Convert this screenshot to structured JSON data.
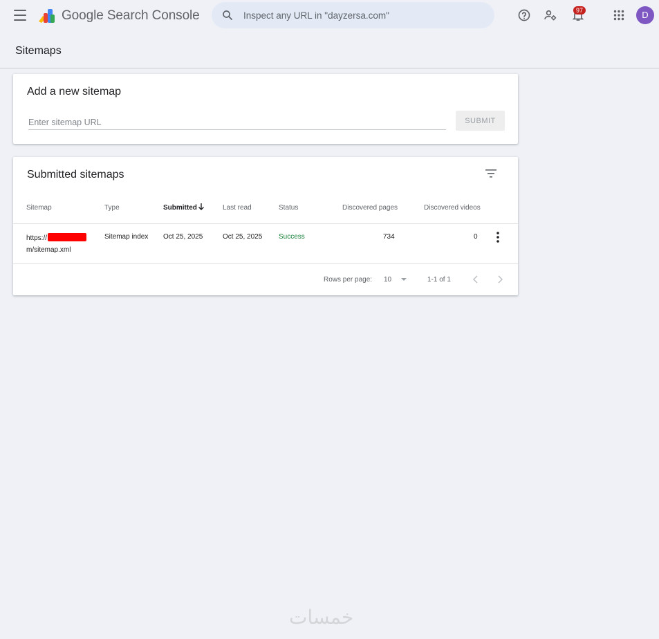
{
  "header": {
    "app_title": "Google Search Console",
    "search_placeholder": "Inspect any URL in \"dayzersa.com\"",
    "notification_count": "97",
    "avatar_letter": "D",
    "icons": [
      "menu-icon",
      "search-console-logo",
      "search-icon",
      "help-icon",
      "account-settings-icon",
      "notifications-icon",
      "apps-icon"
    ]
  },
  "page": {
    "title": "Sitemaps"
  },
  "add_sitemap": {
    "heading": "Add a new sitemap",
    "input_placeholder": "Enter sitemap URL",
    "submit_label": "SUBMIT"
  },
  "submitted": {
    "heading": "Submitted sitemaps",
    "columns": [
      "Sitemap",
      "Type",
      "Submitted",
      "Last read",
      "Status",
      "Discovered pages",
      "Discovered videos"
    ],
    "sorted_column": "Submitted",
    "rows": [
      {
        "sitemap_prefix": "https://",
        "sitemap_suffix": "m/sitemap.xml",
        "type": "Sitemap index",
        "submitted": "Oct 25, 2025",
        "last_read": "Oct 25, 2025",
        "status": "Success",
        "discovered_pages": "734",
        "discovered_videos": "0"
      }
    ],
    "pagination": {
      "rows_per_page_label": "Rows per page:",
      "rows_per_page_value": "10",
      "range": "1-1 of 1"
    }
  },
  "watermark": "خمسات",
  "colors": {
    "background": "#eff1f6",
    "search_bg": "#e3eaf6",
    "badge": "#c5221f",
    "avatar": "#7e57c2",
    "success": "#188038",
    "redaction": "#ff0000"
  }
}
